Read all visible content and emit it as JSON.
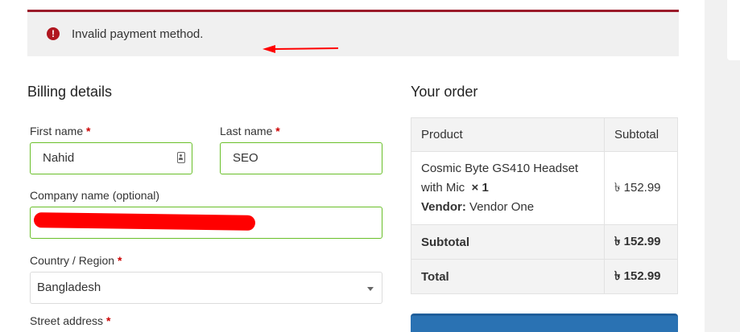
{
  "notice": {
    "message": "Invalid payment method.",
    "icon": "error-icon",
    "border_color": "#9b1b2a"
  },
  "billing": {
    "heading": "Billing details",
    "first_name": {
      "label": "First name",
      "required_mark": "*",
      "value": "Nahid"
    },
    "last_name": {
      "label": "Last name",
      "required_mark": "*",
      "value": "SEO"
    },
    "company": {
      "label": "Company name (optional)",
      "value": ""
    },
    "country": {
      "label": "Country / Region",
      "required_mark": "*",
      "value": "Bangladesh"
    },
    "street": {
      "label": "Street address",
      "required_mark": "*"
    }
  },
  "order": {
    "heading": "Your order",
    "columns": [
      "Product",
      "Subtotal"
    ],
    "item": {
      "name": "Cosmic Byte GS410 Headset with Mic",
      "qty": "× 1",
      "vendor_label": "Vendor:",
      "vendor_name": "Vendor One",
      "price": "৳ 152.99"
    },
    "subtotal": {
      "label": "Subtotal",
      "value": "৳ 152.99"
    },
    "total": {
      "label": "Total",
      "value": "৳ 152.99"
    }
  },
  "colors": {
    "valid_field_border": "#69bf29",
    "button": "#2a72b3",
    "annotation": "#ff0000"
  }
}
